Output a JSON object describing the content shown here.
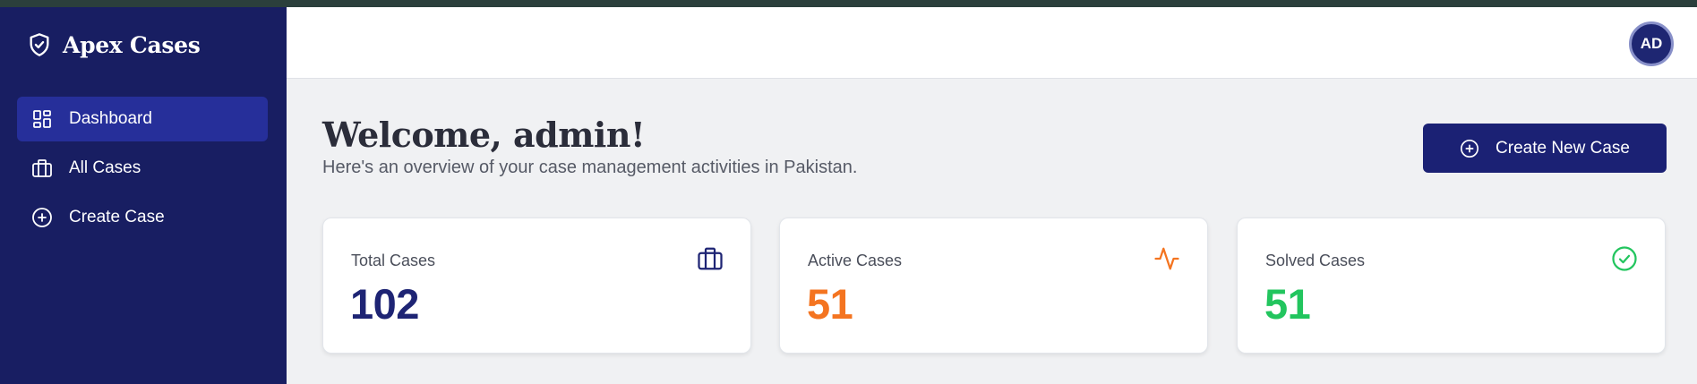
{
  "sidebar": {
    "brand": "Apex Cases",
    "items": [
      {
        "label": "Dashboard",
        "icon": "dashboard-icon"
      },
      {
        "label": "All Cases",
        "icon": "briefcase-icon"
      },
      {
        "label": "Create Case",
        "icon": "plus-circle-icon"
      }
    ]
  },
  "header": {
    "avatar_initials": "AD"
  },
  "main": {
    "title": "Welcome, admin!",
    "subtitle": "Here's an overview of your case management activities in Pakistan.",
    "create_button_label": "Create New Case"
  },
  "stats": [
    {
      "label": "Total Cases",
      "value": "102",
      "color": "#1e2474",
      "icon": "briefcase-icon"
    },
    {
      "label": "Active Cases",
      "value": "51",
      "color": "#f47420",
      "icon": "activity-icon"
    },
    {
      "label": "Solved Cases",
      "value": "51",
      "color": "#22c55e",
      "icon": "check-circle-icon"
    }
  ],
  "colors": {
    "sidebar": "#181e62",
    "sidebar_active": "#262f9a",
    "primary_button": "#1b2174"
  }
}
